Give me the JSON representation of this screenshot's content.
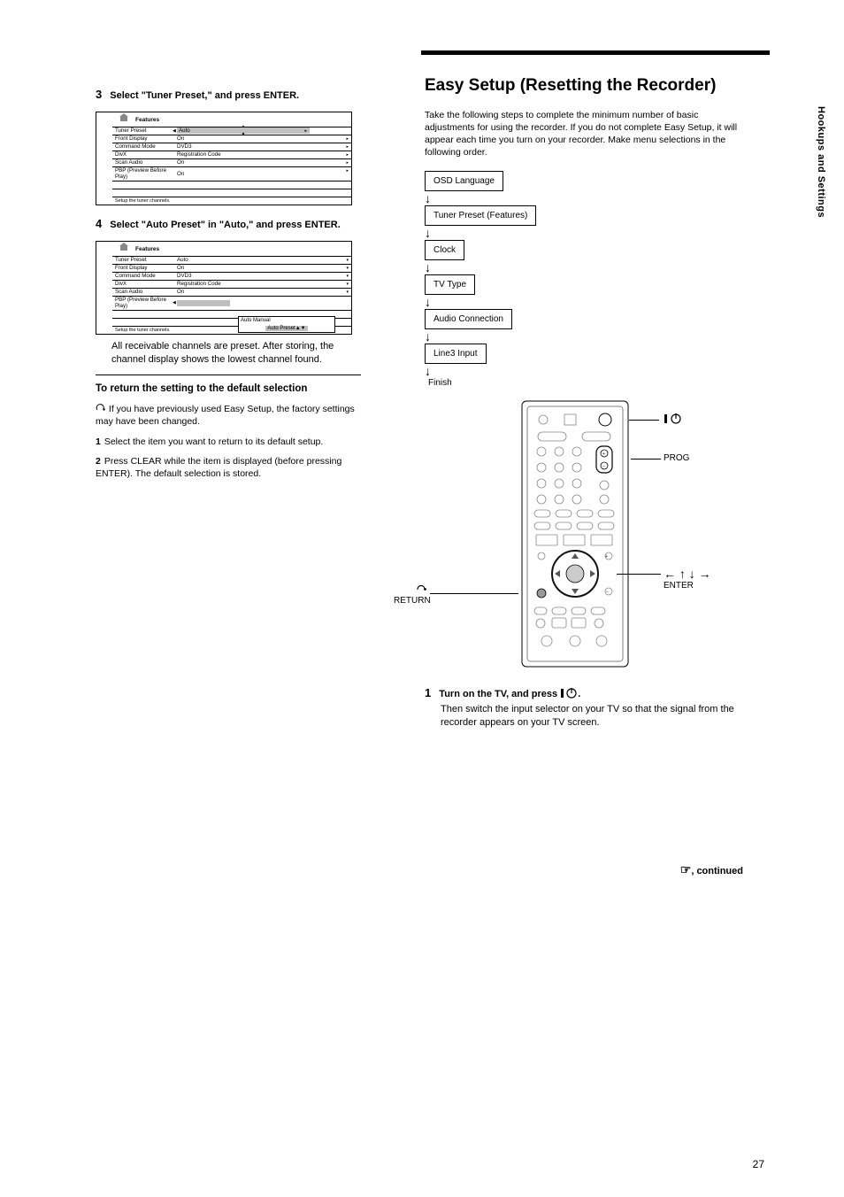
{
  "page_number": "27",
  "side_tab": "Hookups and Settings",
  "top_bar": "",
  "left": {
    "step3": {
      "num": "3",
      "text_a": "Select \"Tuner Preset,\" and press ENTER.",
      "menu_title": "Features",
      "menu_rows": [
        {
          "label": "Tuner Preset",
          "val": "Auto",
          "hl": true
        },
        {
          "label": "Front Display",
          "val": "On",
          "dd": true
        },
        {
          "label": "Command Mode",
          "val": "DVD3",
          "dd": true
        },
        {
          "label": "DivX",
          "val": "Registration Code",
          "dd": true
        },
        {
          "label": "Scan Audio",
          "val": "On",
          "dd": true
        },
        {
          "label": "PBP (Preview Before Play)",
          "val": "On",
          "dd": true
        },
        {
          "label": "",
          "val": ""
        },
        {
          "label": "",
          "val": ""
        }
      ],
      "menu_footer": "Setup the tuner channels."
    },
    "step4": {
      "num": "4",
      "text_a": "Select \"Auto Preset\" in \"Auto,\" and press ENTER.",
      "menu_title": "Features",
      "menu_rows": [
        {
          "label": "Tuner Preset",
          "val": "Auto",
          "dd": true
        },
        {
          "label": "Front Display",
          "val": "On",
          "dd": true
        },
        {
          "label": "Command Mode",
          "val": "DVD3",
          "dd": true
        },
        {
          "label": "DivX",
          "val": "Registration Code",
          "dd": true
        },
        {
          "label": "Scan Audio",
          "val": "On",
          "dd": true
        },
        {
          "label": "PBP (Preview Before Play)",
          "val": "",
          "popup": true
        },
        {
          "label": "",
          "val": ""
        },
        {
          "label": "",
          "val": ""
        }
      ],
      "popup_line1": "Auto     Manual",
      "popup_line2": "Auto Preset",
      "menu_footer": "Setup the tuner channels.",
      "after_text": "All receivable channels are preset. After storing, the channel display shows the lowest channel found."
    },
    "section_heading": "To return the setting to the default selection",
    "note_intro": "If you have previously used",
    "note_intro_2": "Easy Setup, the factory settings may have been changed.",
    "sub1": {
      "num": "1",
      "text": "Select the item you want to return to its default setup."
    },
    "sub2": {
      "num": "2",
      "text": "Press CLEAR while the item is displayed (before pressing ENTER). The default selection is stored."
    }
  },
  "right": {
    "heading": "Easy Setup (Resetting the Recorder)",
    "intro": "Take the following steps to complete the minimum number of basic adjustments for using the recorder. If you do not complete Easy Setup, it will appear each time you turn on your recorder. Make menu selections in the following order.",
    "flow": [
      "OSD Language",
      "Tuner Preset (Features)",
      "Clock",
      "TV Type",
      "Audio Connection",
      "Line3 Input"
    ],
    "flow_finish": "Finish",
    "remote_labels": {
      "power": "",
      "prog": "PROG",
      "return": "RETURN",
      "enter": "ENTER",
      "arrows": ""
    },
    "step1": {
      "num": "1",
      "text": "Turn on the TV, and press    .",
      "sub": "Then switch the input selector on your TV so that the signal from the recorder appears on your TV screen."
    },
    "continued": ", continued"
  }
}
